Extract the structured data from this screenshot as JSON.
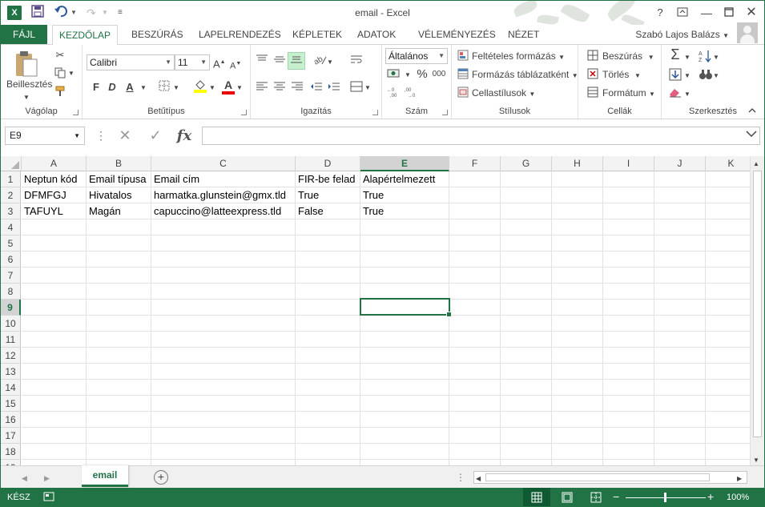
{
  "window": {
    "title": "email - Excel",
    "app_icon": "X",
    "help": "?",
    "controls": [
      "ribbon-display-icon",
      "minimize-icon",
      "maximize-icon",
      "close-icon"
    ]
  },
  "tabs": {
    "file": "FÁJL",
    "items": [
      "KEZDŐLAP",
      "BESZÚRÁS",
      "LAPELRENDEZÉS",
      "KÉPLETEK",
      "ADATOK",
      "VÉLEMÉNYEZÉS",
      "NÉZET"
    ],
    "active_index": 0,
    "user": "Szabó Lajos Balázs"
  },
  "ribbon": {
    "clipboard": {
      "label": "Vágólap",
      "paste": "Beillesztés"
    },
    "font": {
      "label": "Betűtípus",
      "name": "Calibri",
      "size": "11",
      "bold": "F",
      "italic": "D",
      "underline": "A",
      "grow": "A",
      "shrink": "A",
      "color": "A"
    },
    "alignment": {
      "label": "Igazítás"
    },
    "number": {
      "label": "Szám",
      "format": "Általános",
      "percent": "%",
      "thousands": "000"
    },
    "styles": {
      "label": "Stílusok",
      "conditional": "Feltételes formázás",
      "table": "Formázás táblázatként",
      "cell": "Cellastílusok"
    },
    "cells": {
      "label": "Cellák",
      "insert": "Beszúrás",
      "delete": "Törlés",
      "format": "Formátum"
    },
    "editing": {
      "label": "Szerkesztés",
      "sigma": "Σ"
    }
  },
  "formula_bar": {
    "name_box": "E9",
    "fx": "fx",
    "value": ""
  },
  "grid": {
    "columns": [
      "A",
      "B",
      "C",
      "D",
      "E",
      "F",
      "G",
      "H",
      "I",
      "J",
      "K"
    ],
    "selected_column": "E",
    "rows": [
      "1",
      "2",
      "3",
      "4",
      "5",
      "6",
      "7",
      "8",
      "9",
      "10",
      "11",
      "12",
      "13",
      "14",
      "15",
      "16",
      "17",
      "18",
      "19"
    ],
    "selected_row": "9",
    "cells": [
      [
        "Neptun kód",
        "Email típusa",
        "Email cím",
        "FIR-be felad",
        "Alapértelmezett"
      ],
      [
        "DFMFGJ",
        "Hivatalos",
        "harmatka.glunstein@gmx.tld",
        "True",
        "True"
      ],
      [
        "TAFUYL",
        "Magán",
        "capuccino@latteexpress.tld",
        "False",
        "True"
      ]
    ]
  },
  "sheets": {
    "active": "email"
  },
  "status": {
    "mode": "KÉSZ",
    "zoom": "100%"
  },
  "colors": {
    "accent": "#217346"
  }
}
